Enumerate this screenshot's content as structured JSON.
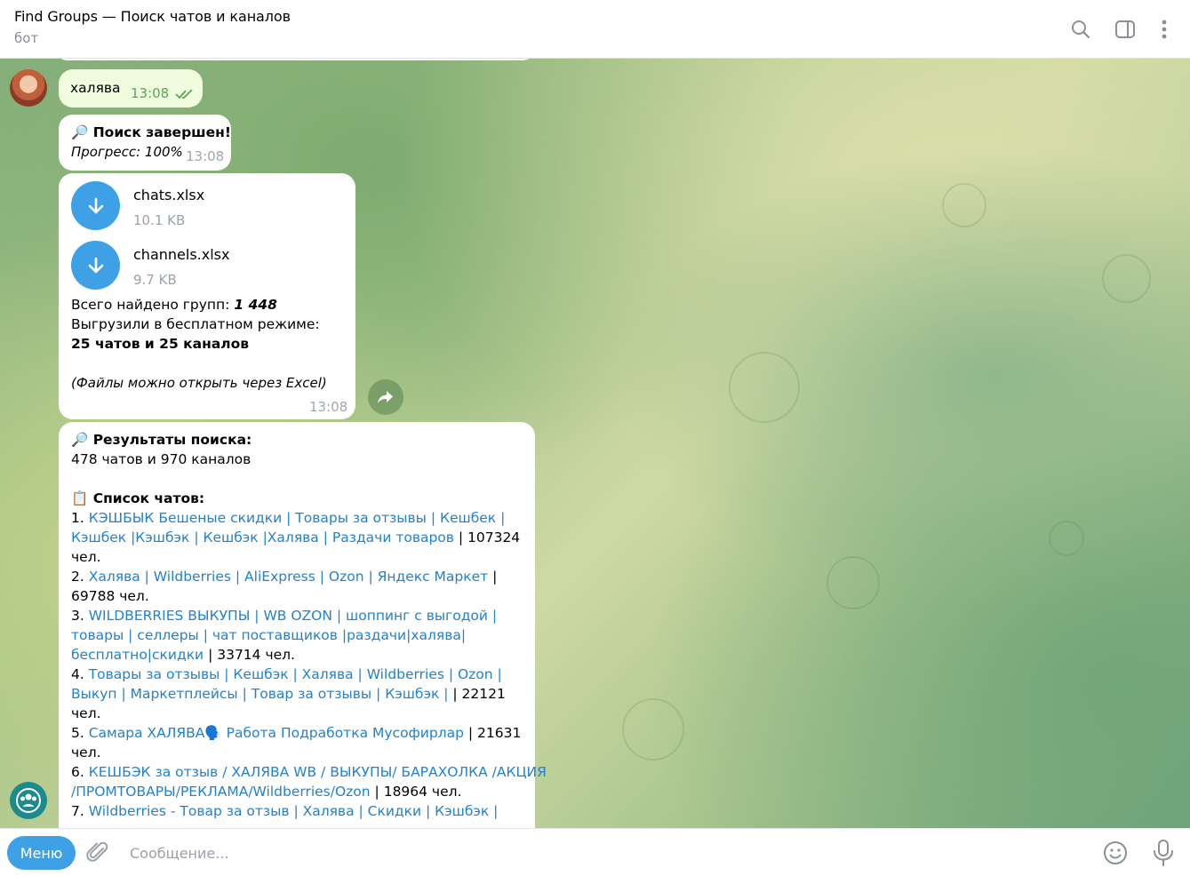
{
  "header": {
    "title": "Find Groups — Поиск чатов и каналов",
    "subtitle": "бот"
  },
  "icons": [
    "search-icon",
    "sidebar-toggle-icon",
    "more-vertical-icon",
    "download-icon",
    "share-icon",
    "paperclip-icon",
    "emoji-icon",
    "microphone-icon",
    "double-check-icon"
  ],
  "colors": {
    "accent": "#3ea1e5",
    "link": "#2481cc",
    "outgoing_bubble": "#effdde",
    "time_out": "#5ea35a"
  },
  "messages": {
    "user": {
      "text": "халява",
      "time": "13:08"
    },
    "progress": {
      "title": "🔎 Поиск завершен!",
      "progress": "Прогресс: 100%",
      "time": "13:08"
    },
    "files": {
      "items": [
        {
          "name": "chats.xlsx",
          "size": "10.1 KB"
        },
        {
          "name": "channels.xlsx",
          "size": "9.7 KB"
        }
      ],
      "total_label": "Всего найдено групп: ",
      "total_value": "1 448",
      "free_mode": "Выгрузили в бесплатном режиме:",
      "counts": "25 чатов и 25 каналов",
      "note": "(Файлы можно открыть через Excel)",
      "time": "13:08"
    },
    "results": {
      "title": "🔎 Результаты поиска:",
      "summary": "478 чатов и 970 каналов",
      "list_title": "📋 Список чатов:",
      "lines": [
        {
          "pre": "1. ",
          "link": "КЭШБЫК Бешеные скидки | Товары за отзывы | Кешбек |",
          "post": ""
        },
        {
          "pre": "",
          "link": "Кэшбек |Кэшбэк | Кешбэк |Халява | Раздачи товаров",
          "post": " | 107324"
        },
        {
          "pre": "",
          "link": "",
          "post": "чел."
        },
        {
          "pre": "2. ",
          "link": "Халява | Wildberries | AliExpress | Ozon | Яндекс Маркет",
          "post": " |"
        },
        {
          "pre": "",
          "link": "",
          "post": "69788 чел."
        },
        {
          "pre": "3. ",
          "link": "WILDBERRIES ВЫКУПЫ | WB OZON | шоппинг с выгодой |",
          "post": ""
        },
        {
          "pre": "",
          "link": "товары | селлеры | чат поставщиков |раздачи|халява|",
          "post": ""
        },
        {
          "pre": "",
          "link": "бесплатно|скидки",
          "post": " | 33714 чел."
        },
        {
          "pre": "4. ",
          "link": "Товары за отзывы | Кешбэк | Халява | Wildberries | Ozon |",
          "post": ""
        },
        {
          "pre": "",
          "link": "Выкуп | Маркетплейсы | Товар за отзывы | Кэшбэк |",
          "post": " | 22121"
        },
        {
          "pre": "",
          "link": "",
          "post": "чел."
        },
        {
          "pre": "5. ",
          "link": "Самара ХАЛЯВА🗣️ Работа Подработка Мусофирлар",
          "post": " | 21631"
        },
        {
          "pre": "",
          "link": "",
          "post": "чел."
        },
        {
          "pre": "6. ",
          "link": "КЕШБЭК за отзыв / ХАЛЯВА WB / ВЫКУПЫ/ БАРАХОЛКА /АКЦИЯ",
          "post": ""
        },
        {
          "pre": "",
          "link": "/ПРОМТОВАРЫ/РЕКЛАМА/Wildberries/Ozon",
          "post": " | 18964 чел."
        },
        {
          "pre": "7. ",
          "link": "Wildberries - Товар за отзыв | Халява | Скидки | Кэшбэк |",
          "post": ""
        }
      ]
    }
  },
  "input": {
    "menu_label": "Меню",
    "placeholder": "Сообщение..."
  }
}
